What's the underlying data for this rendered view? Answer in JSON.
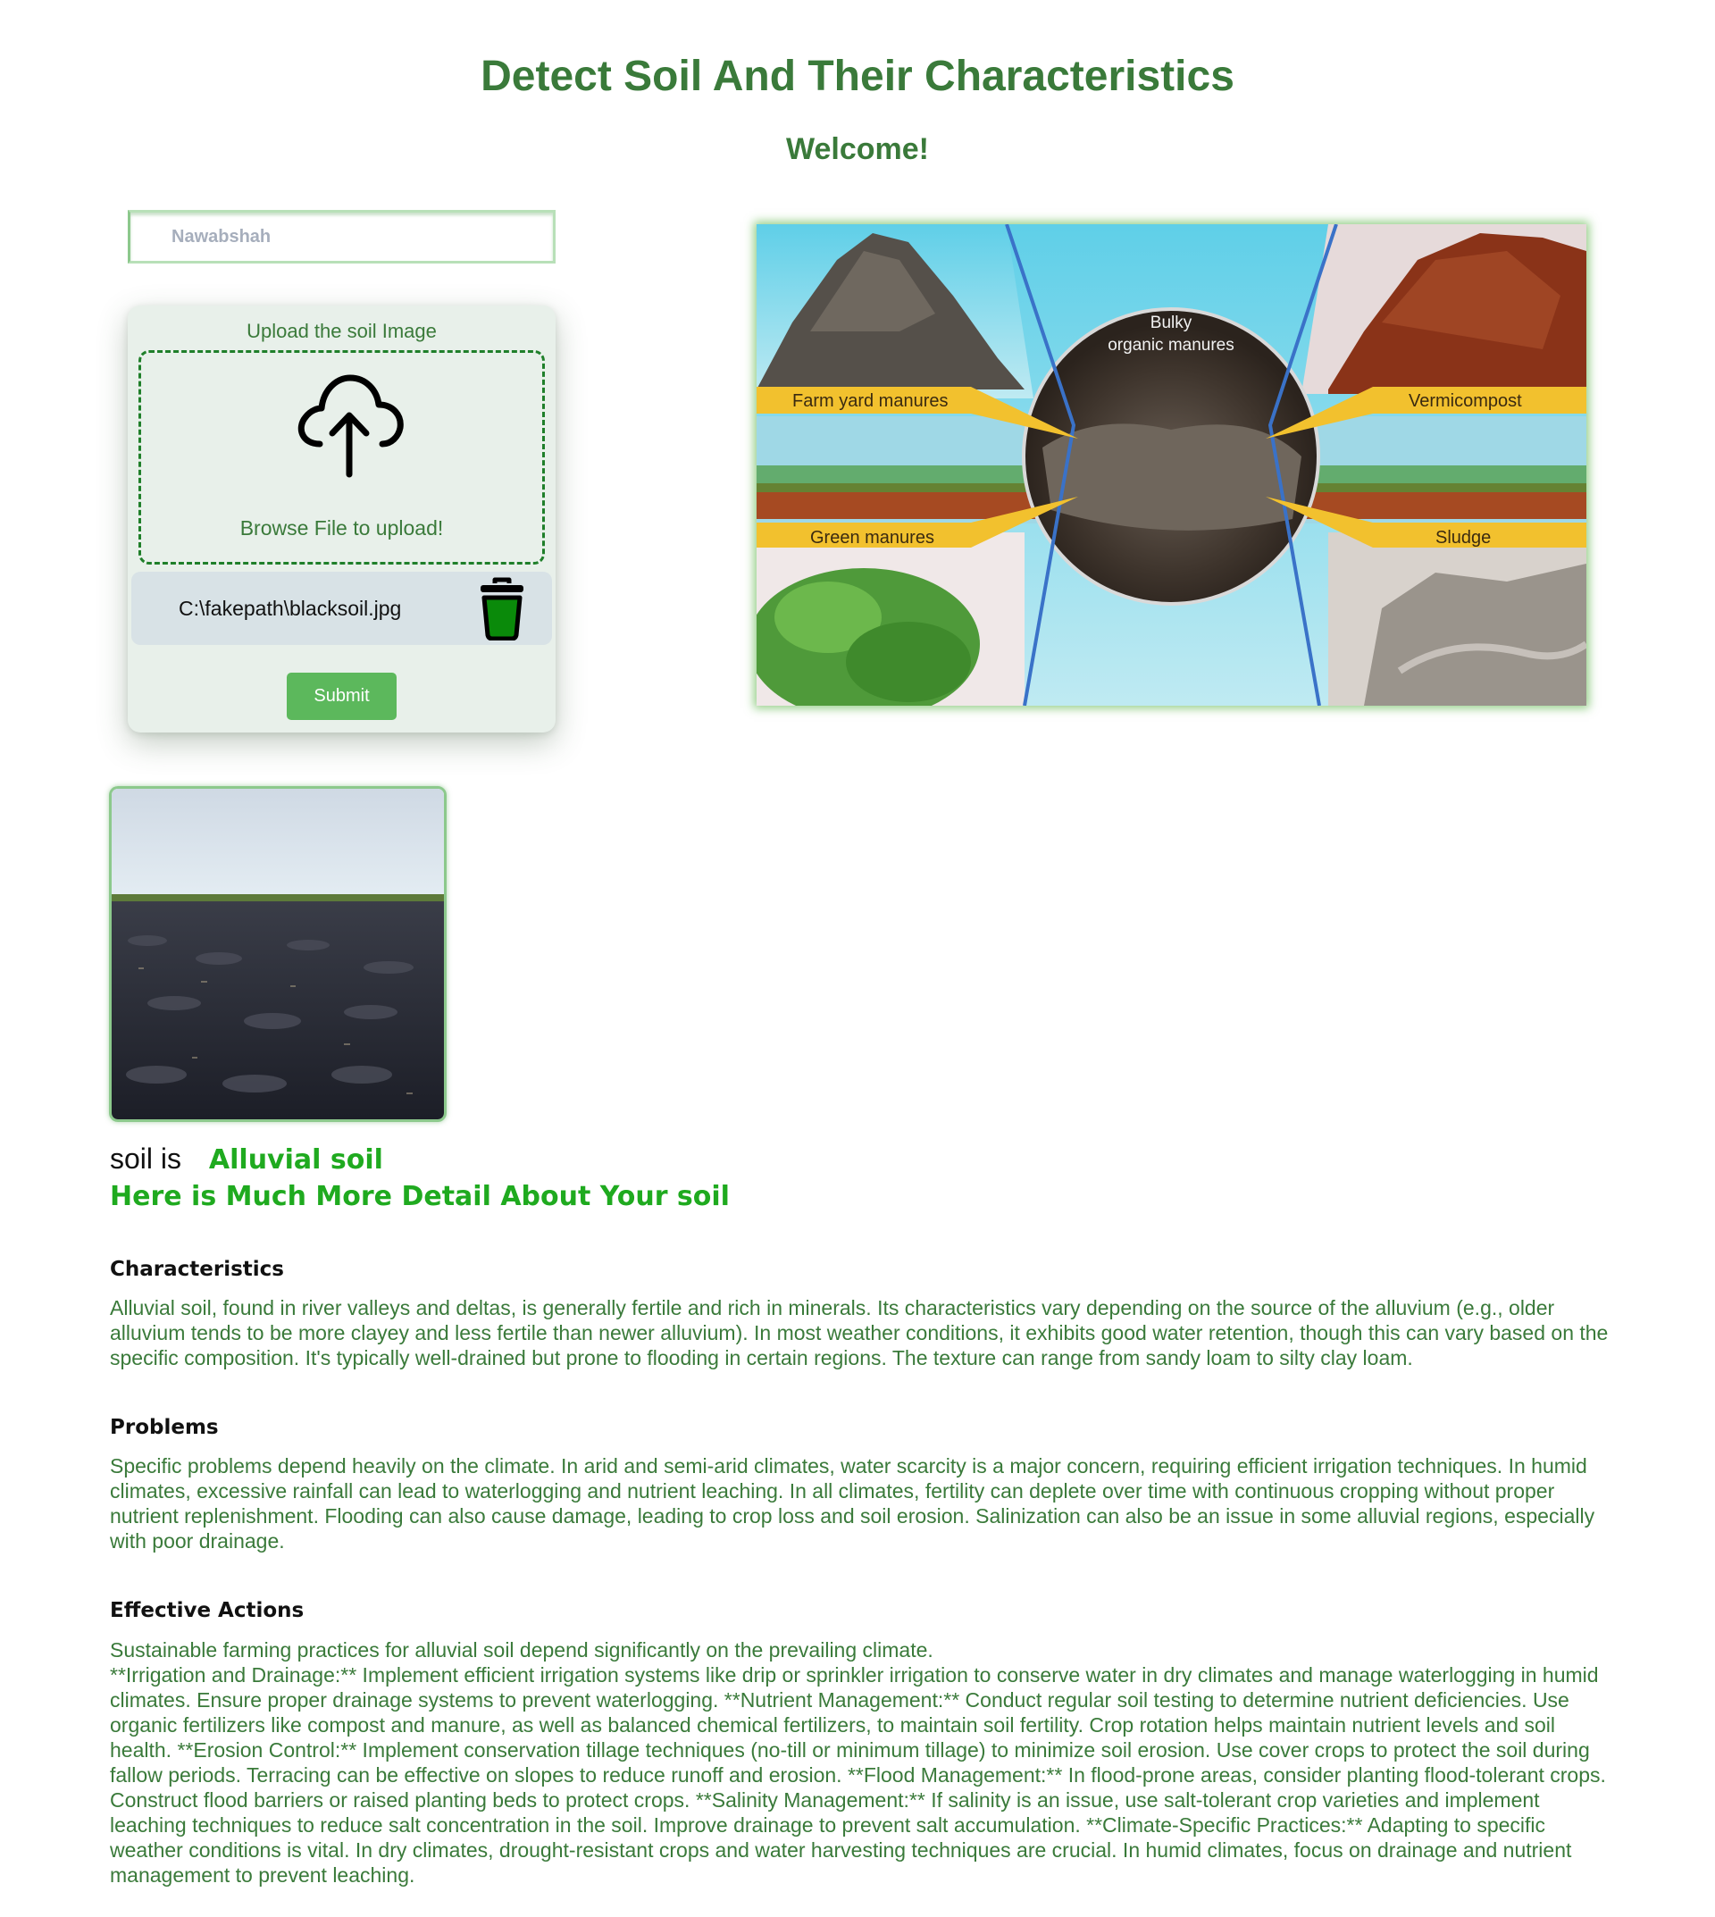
{
  "header": {
    "title": "Detect Soil And Their Characteristics",
    "welcome": "Welcome!"
  },
  "location": {
    "value": "Nawabshah"
  },
  "upload": {
    "heading": "Upload the soil Image",
    "browse_label": "Browse File to upload!",
    "file_name": "C:\\fakepath\\blacksoil.jpg",
    "submit_label": "Submit"
  },
  "hero": {
    "center_label_line1": "Bulky",
    "center_label_line2": "organic manures",
    "labels": [
      "Farm yard manures",
      "Vermicompost",
      "Green manures",
      "Sludge"
    ]
  },
  "result": {
    "prefix": "soil is",
    "soil_type": "Alluvial soil",
    "detail_heading": "Here is Much More Detail About Your soil"
  },
  "sections": [
    {
      "heading": "Characteristics",
      "body": "Alluvial soil, found in river valleys and deltas, is generally fertile and rich in minerals. Its characteristics vary depending on the source of the alluvium (e.g., older alluvium tends to be more clayey and less fertile than newer alluvium). In most weather conditions, it exhibits good water retention, though this can vary based on the specific composition. It's typically well-drained but prone to flooding in certain regions. The texture can range from sandy loam to silty clay loam."
    },
    {
      "heading": "Problems",
      "body": "Specific problems depend heavily on the climate. In arid and semi-arid climates, water scarcity is a major concern, requiring efficient irrigation techniques. In humid climates, excessive rainfall can lead to waterlogging and nutrient leaching. In all climates, fertility can deplete over time with continuous cropping without proper nutrient replenishment. Flooding can also cause damage, leading to crop loss and soil erosion. Salinization can also be an issue in some alluvial regions, especially with poor drainage."
    },
    {
      "heading": "Effective Actions",
      "intro": "Sustainable farming practices for alluvial soil depend significantly on the prevailing climate.",
      "body": "**Irrigation and Drainage:** Implement efficient irrigation systems like drip or sprinkler irrigation to conserve water in dry climates and manage waterlogging in humid climates. Ensure proper drainage systems to prevent waterlogging. **Nutrient Management:** Conduct regular soil testing to determine nutrient deficiencies. Use organic fertilizers like compost and manure, as well as balanced chemical fertilizers, to maintain soil fertility. Crop rotation helps maintain nutrient levels and soil health. **Erosion Control:** Implement conservation tillage techniques (no-till or minimum tillage) to minimize soil erosion. Use cover crops to protect the soil during fallow periods. Terracing can be effective on slopes to reduce runoff and erosion. **Flood Management:** In flood-prone areas, consider planting flood-tolerant crops. Construct flood barriers or raised planting beds to protect crops. **Salinity Management:** If salinity is an issue, use salt-tolerant crop varieties and implement leaching techniques to reduce salt concentration in the soil. Improve drainage to prevent salt accumulation. **Climate-Specific Practices:** Adapting to specific weather conditions is vital. In dry climates, drought-resistant crops and water harvesting techniques are crucial. In humid climates, focus on drainage and nutrient management to prevent leaching."
    }
  ],
  "icons": {
    "upload": "cloud-upload-icon",
    "delete": "trash-icon"
  },
  "colors": {
    "title_green": "#3a7a3a",
    "result_green": "#1faa1f",
    "submit_green": "#5cb85c",
    "dashed_border": "#1f7f2a",
    "trash_fill": "#0a8a0a"
  }
}
